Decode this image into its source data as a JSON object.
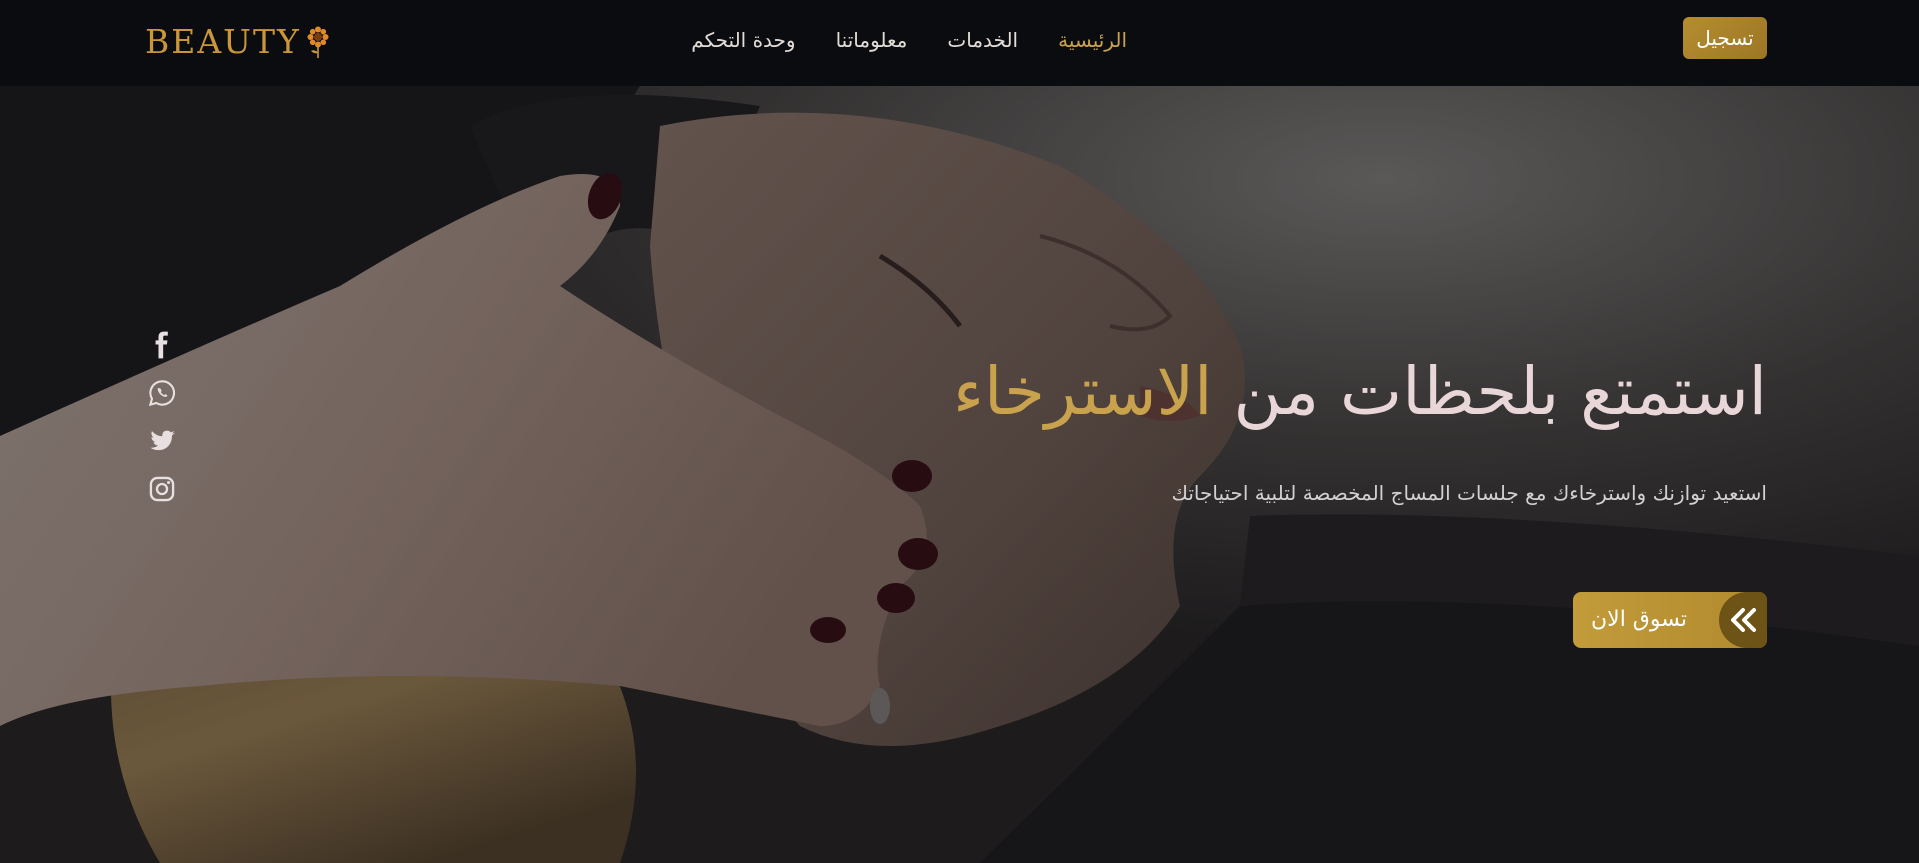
{
  "brand": {
    "logo_text": "BEAUTY",
    "accent_color": "#c9a24d",
    "logo_color": "#c9973a"
  },
  "nav": {
    "links": [
      {
        "label": "الرئيسية",
        "active": true
      },
      {
        "label": "الخدمات",
        "active": false
      },
      {
        "label": "معلوماتنا",
        "active": false
      },
      {
        "label": "وحدة التحكم",
        "active": false
      }
    ],
    "register_label": "تسجيل"
  },
  "hero": {
    "title_main": "استمتع بلحظات من",
    "title_accent": "الاسترخاء",
    "subtitle": "استعيد توازنك واسترخاءك مع جلسات المساج المخصصة لتلبية احتياجاتك",
    "cta_label": "تسوق الان",
    "cta_icon": "double-chevron-left-icon"
  },
  "social": [
    {
      "name": "facebook-icon"
    },
    {
      "name": "whatsapp-icon"
    },
    {
      "name": "twitter-icon"
    },
    {
      "name": "instagram-icon"
    }
  ]
}
